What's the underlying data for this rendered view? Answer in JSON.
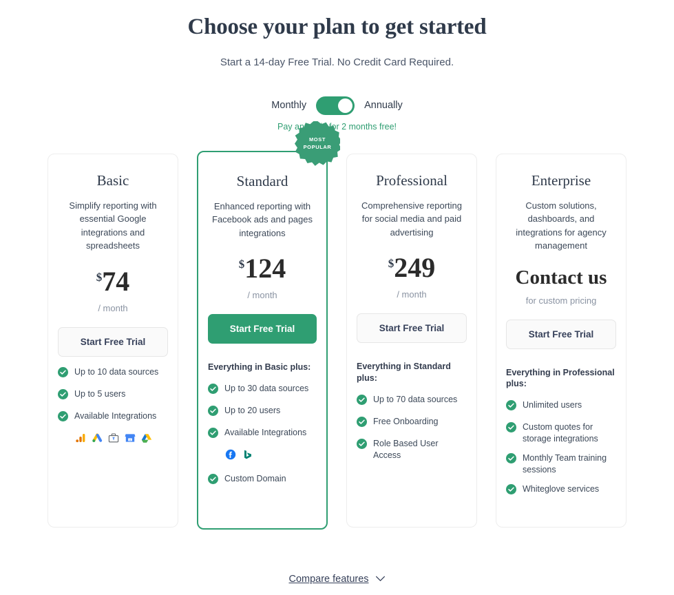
{
  "header": {
    "title": "Choose your plan to get started",
    "subtitle": "Start a 14-day Free Trial. No Credit Card Required."
  },
  "billing": {
    "monthly_label": "Monthly",
    "annually_label": "Annually",
    "selected": "Annually",
    "note": "Pay annually for 2 months free!",
    "toggle_color": "#2f9e72"
  },
  "badge": {
    "line1": "MOST",
    "line2": "POPULAR"
  },
  "plans": [
    {
      "name": "Basic",
      "description": "Simplify reporting with essential Google integrations and spreadsheets",
      "currency": "$",
      "price": "74",
      "period": "/ month",
      "cta": "Start Free Trial",
      "cta_style": "outline",
      "features_head": "",
      "features": [
        "Up to 10 data sources",
        "Up to 5 users",
        "Available Integrations"
      ],
      "integrations": [
        "google-analytics-icon",
        "google-ads-icon",
        "google-search-console-icon",
        "google-business-profile-icon",
        "google-drive-icon"
      ],
      "extra_features": [],
      "featured": false
    },
    {
      "name": "Standard",
      "description": "Enhanced reporting with Facebook ads and pages integrations",
      "currency": "$",
      "price": "124",
      "period": "/ month",
      "cta": "Start Free Trial",
      "cta_style": "solid",
      "features_head": "Everything in Basic plus:",
      "features": [
        "Up to 30 data sources",
        "Up to 20 users",
        "Available Integrations"
      ],
      "integrations": [
        "facebook-icon",
        "bing-icon"
      ],
      "extra_features": [
        "Custom Domain"
      ],
      "featured": true
    },
    {
      "name": "Professional",
      "description": "Comprehensive reporting for social media and paid advertising",
      "currency": "$",
      "price": "249",
      "period": "/ month",
      "cta": "Start Free Trial",
      "cta_style": "outline",
      "features_head": "Everything in Standard plus:",
      "features": [
        "Up to 70 data sources",
        "Free Onboarding",
        "Role Based User Access"
      ],
      "integrations": [],
      "extra_features": [],
      "featured": false
    },
    {
      "name": "Enterprise",
      "description": "Custom solutions, dashboards, and integrations for agency management",
      "currency": "",
      "price": "Contact us",
      "period": "for custom pricing",
      "cta": "Start Free Trial",
      "cta_style": "outline",
      "features_head": "Everything in Professional plus:",
      "features": [
        "Unlimited users",
        "Custom quotes for storage integrations",
        "Monthly Team training sessions",
        "Whiteglove services"
      ],
      "integrations": [],
      "extra_features": [],
      "featured": false
    }
  ],
  "footer": {
    "compare_label": "Compare features",
    "chevron": "chevron-down-icon"
  },
  "colors": {
    "brand_green": "#2f9e72",
    "text_dark": "#2f3a4a",
    "text_body": "#3c4858",
    "muted": "#8a93a2"
  }
}
